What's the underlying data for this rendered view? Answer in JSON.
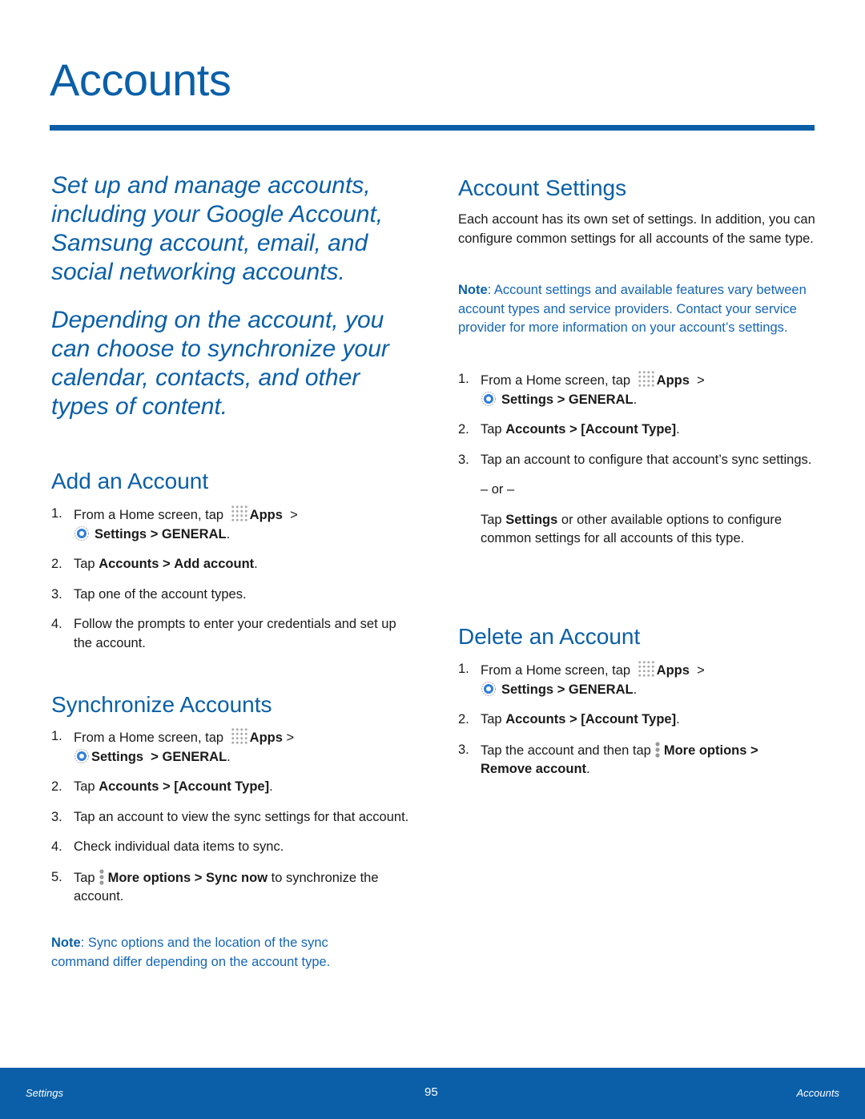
{
  "page": {
    "title": "Accounts",
    "accent_color": "#0a5fa8"
  },
  "intro": {
    "paragraph1": "Set up and manage accounts, including your Google Account, Samsung account, email, and social networking accounts.",
    "paragraph2": "Depending on the account, you can choose to synchronize your calendar, contacts, and other types of content."
  },
  "common": {
    "from_home": "From a Home screen, tap",
    "apps": "Apps",
    "gt": ">",
    "settings": "Settings",
    "general": "GENERAL",
    "period": ".",
    "tap": "Tap",
    "accounts": "Accounts",
    "account_type": "[Account Type]",
    "more_options": "More options",
    "icons": {
      "apps": "apps-grid-icon",
      "settings": "settings-gear-icon",
      "more": "more-options-vertical-dots-icon"
    }
  },
  "add_account": {
    "heading": "Add an Account",
    "step_numbers": [
      "1.",
      "2.",
      "3.",
      "4."
    ],
    "step2_bold": "Add account",
    "step3": "Tap one of the account types.",
    "step4": "Follow the prompts to enter your credentials and set up the account."
  },
  "sync_accounts": {
    "heading": "Synchronize Accounts",
    "step_numbers": [
      "1.",
      "2.",
      "3.",
      "4.",
      "5."
    ],
    "step3": "Tap an account to view the sync settings for that account.",
    "step4": "Check individual data items to sync.",
    "step5_bold2": "Sync now",
    "step5_tail": "to synchronize the account.",
    "note_label": "Note",
    "note_text": ": Sync options and the location of the sync command differ depending on the account type."
  },
  "account_settings": {
    "heading": "Account Settings",
    "intro": "Each account has its own set of settings. In addition, you can configure common settings for all accounts of the same type.",
    "note_label": "Note",
    "note_text": ": Account settings and available features vary between account types and service providers. Contact your service provider for more information on your account’s settings.",
    "step_numbers": [
      "1.",
      "2.",
      "3."
    ],
    "step3": "Tap an account to configure that account’s sync settings.",
    "or": "– or –",
    "alt_pre": "Tap",
    "alt_bold": "Settings",
    "alt_tail": "or other available options to configure common settings for all accounts of this type."
  },
  "delete_account": {
    "heading": "Delete an Account",
    "step_numbers": [
      "1.",
      "2.",
      "3."
    ],
    "step3_pre": "Tap the account and then tap",
    "step3_bold2": "Remove account"
  },
  "footer": {
    "left": "Settings",
    "page_number": "95",
    "right": "Accounts"
  }
}
